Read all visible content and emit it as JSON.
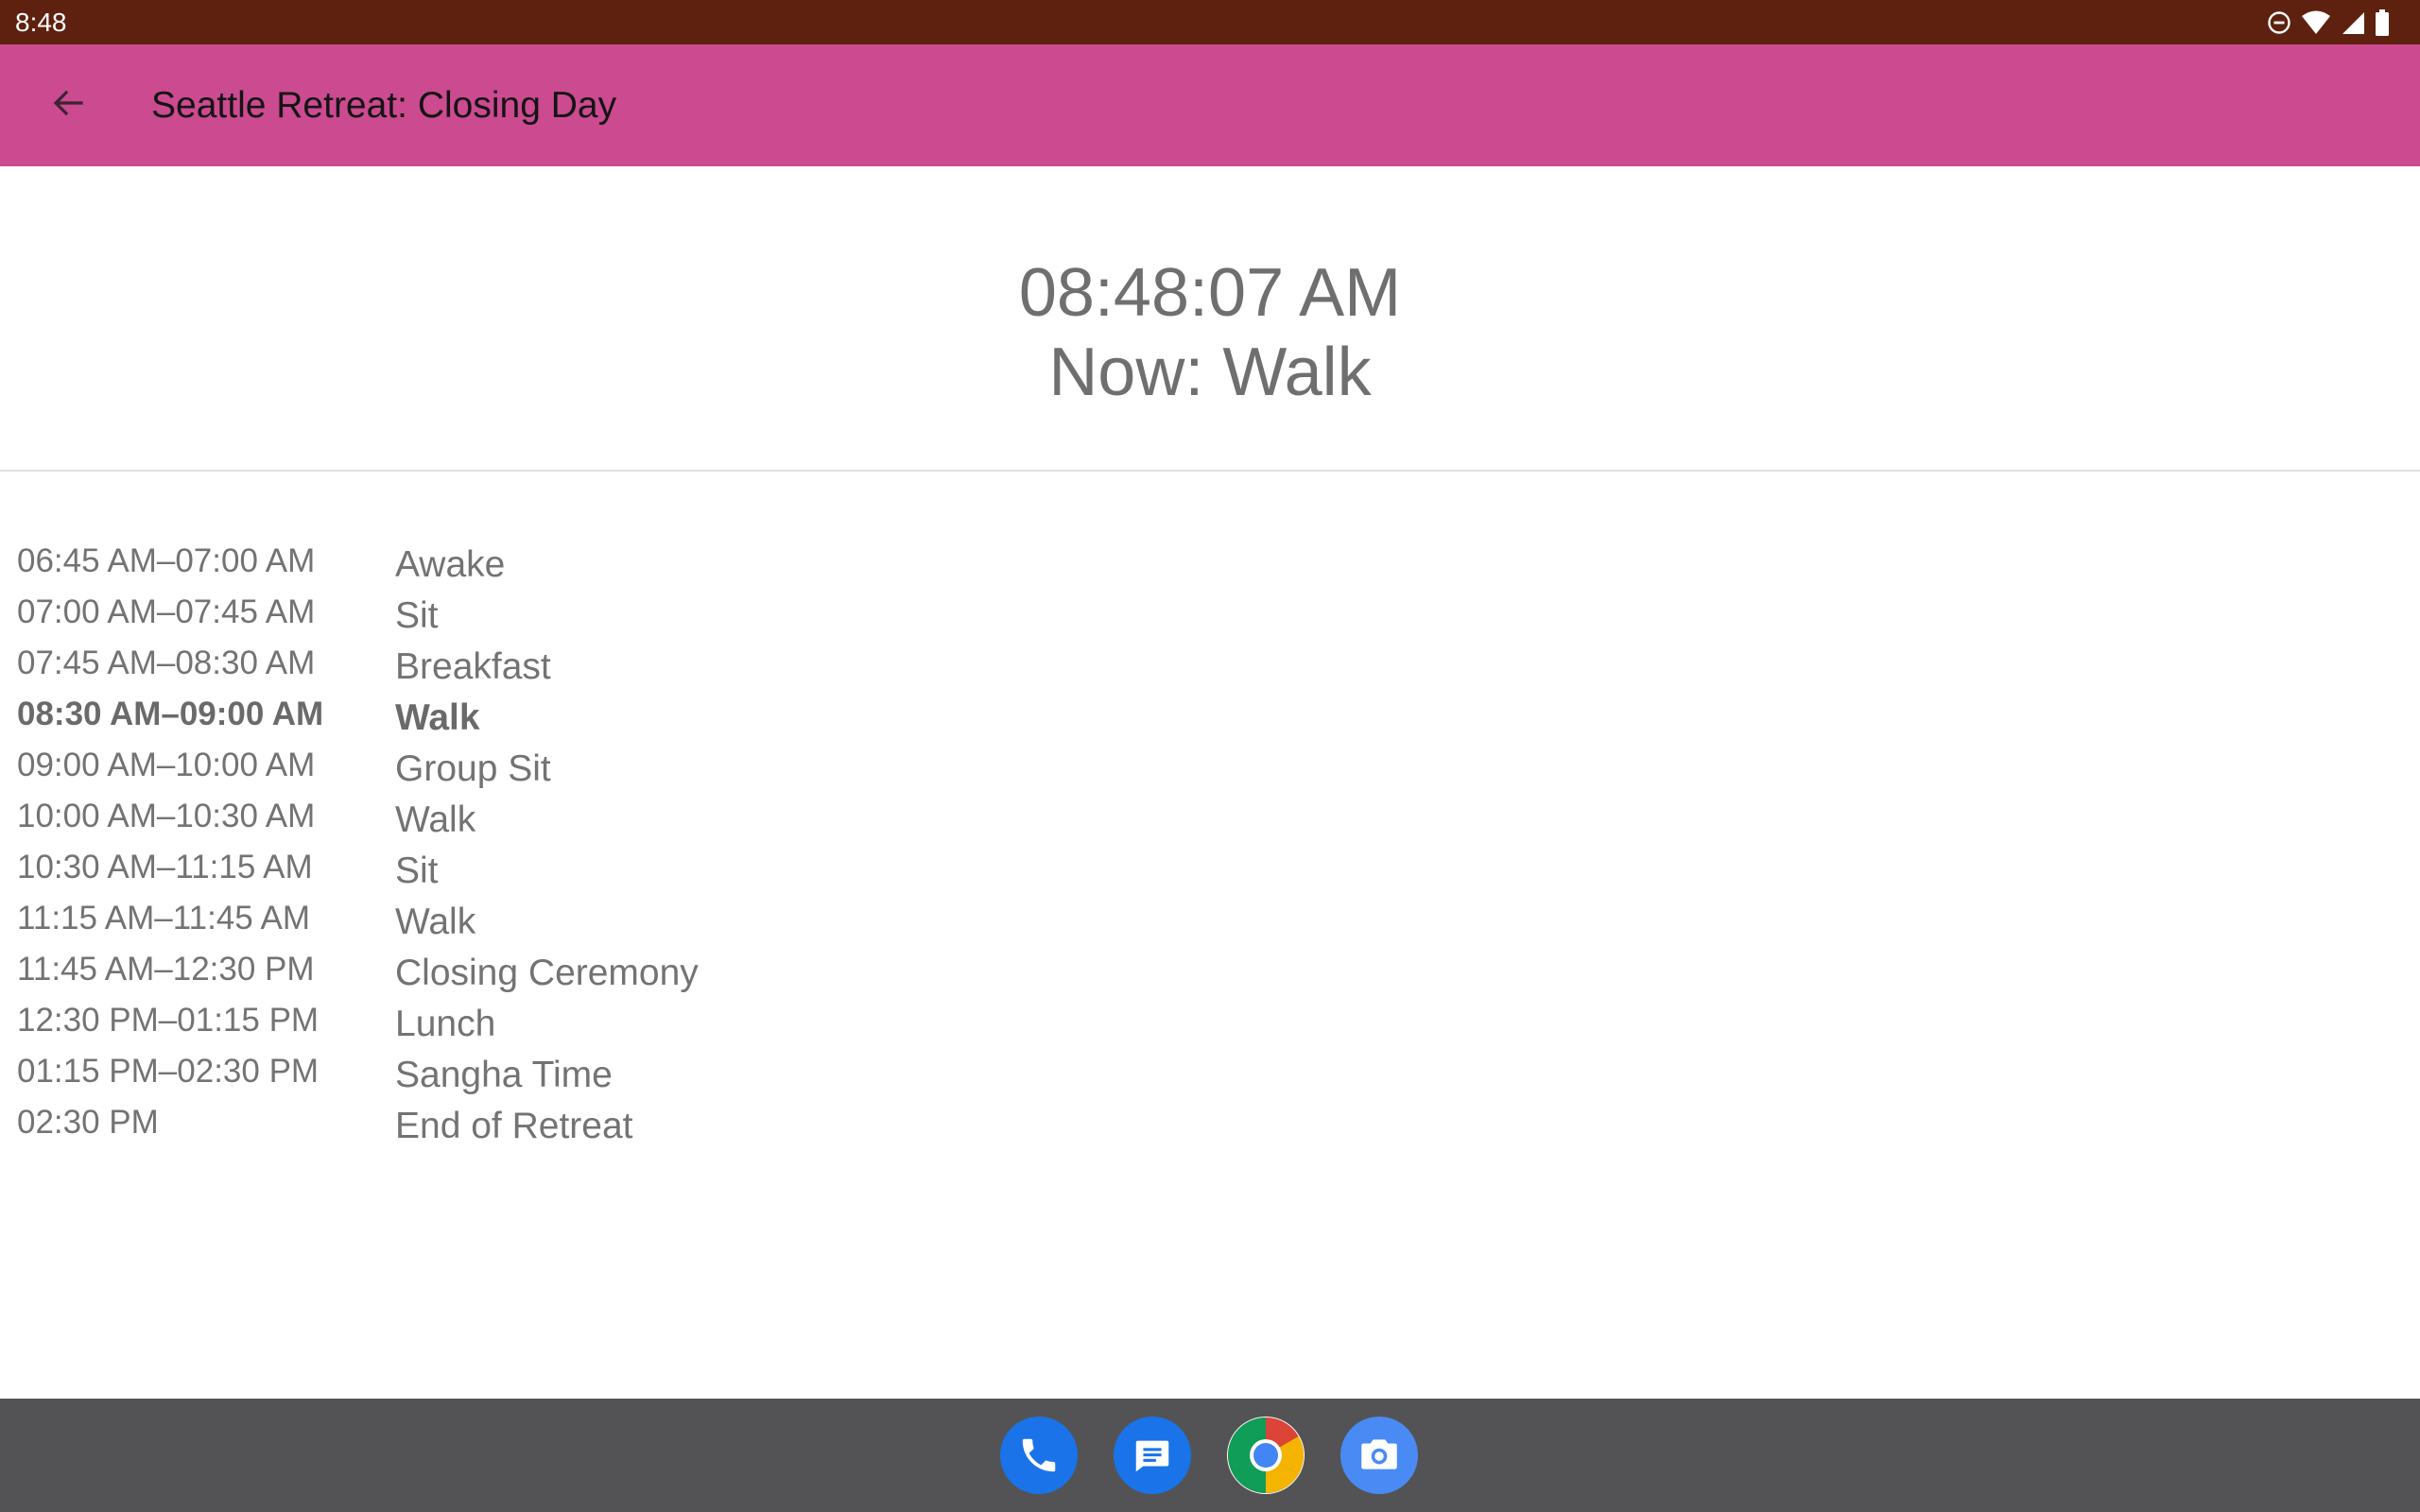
{
  "status_bar": {
    "time": "8:48",
    "icons": [
      "do-not-disturb-icon",
      "wifi-icon",
      "cell-signal-icon",
      "battery-icon"
    ]
  },
  "app_bar": {
    "back_icon": "arrow-back-icon",
    "title": "Seattle Retreat: Closing Day",
    "color": "#cb4a90"
  },
  "header": {
    "clock": "08:48:07 AM",
    "now": "Now: Walk"
  },
  "schedule": [
    {
      "time": "06:45 AM–07:00 AM",
      "activity": "Awake",
      "current": false
    },
    {
      "time": "07:00 AM–07:45 AM",
      "activity": "Sit",
      "current": false
    },
    {
      "time": "07:45 AM–08:30 AM",
      "activity": "Breakfast",
      "current": false
    },
    {
      "time": "08:30 AM–09:00 AM",
      "activity": "Walk",
      "current": true
    },
    {
      "time": "09:00 AM–10:00 AM",
      "activity": "Group Sit",
      "current": false
    },
    {
      "time": "10:00 AM–10:30 AM",
      "activity": "Walk",
      "current": false
    },
    {
      "time": "10:30 AM–11:15 AM",
      "activity": "Sit",
      "current": false
    },
    {
      "time": "11:15 AM–11:45 AM",
      "activity": "Walk",
      "current": false
    },
    {
      "time": "11:45 AM–12:30 PM",
      "activity": "Closing Ceremony",
      "current": false
    },
    {
      "time": "12:30 PM–01:15 PM",
      "activity": "Lunch",
      "current": false
    },
    {
      "time": "01:15 PM–02:30 PM",
      "activity": "Sangha Time",
      "current": false
    },
    {
      "time": "02:30 PM",
      "activity": "End of Retreat",
      "current": false
    }
  ],
  "dock": {
    "apps": [
      "phone-icon",
      "messages-icon",
      "chrome-icon",
      "camera-icon"
    ]
  },
  "colors": {
    "status_bar": "#5f210f",
    "dock": "#535355",
    "text_gray": "#737373"
  }
}
